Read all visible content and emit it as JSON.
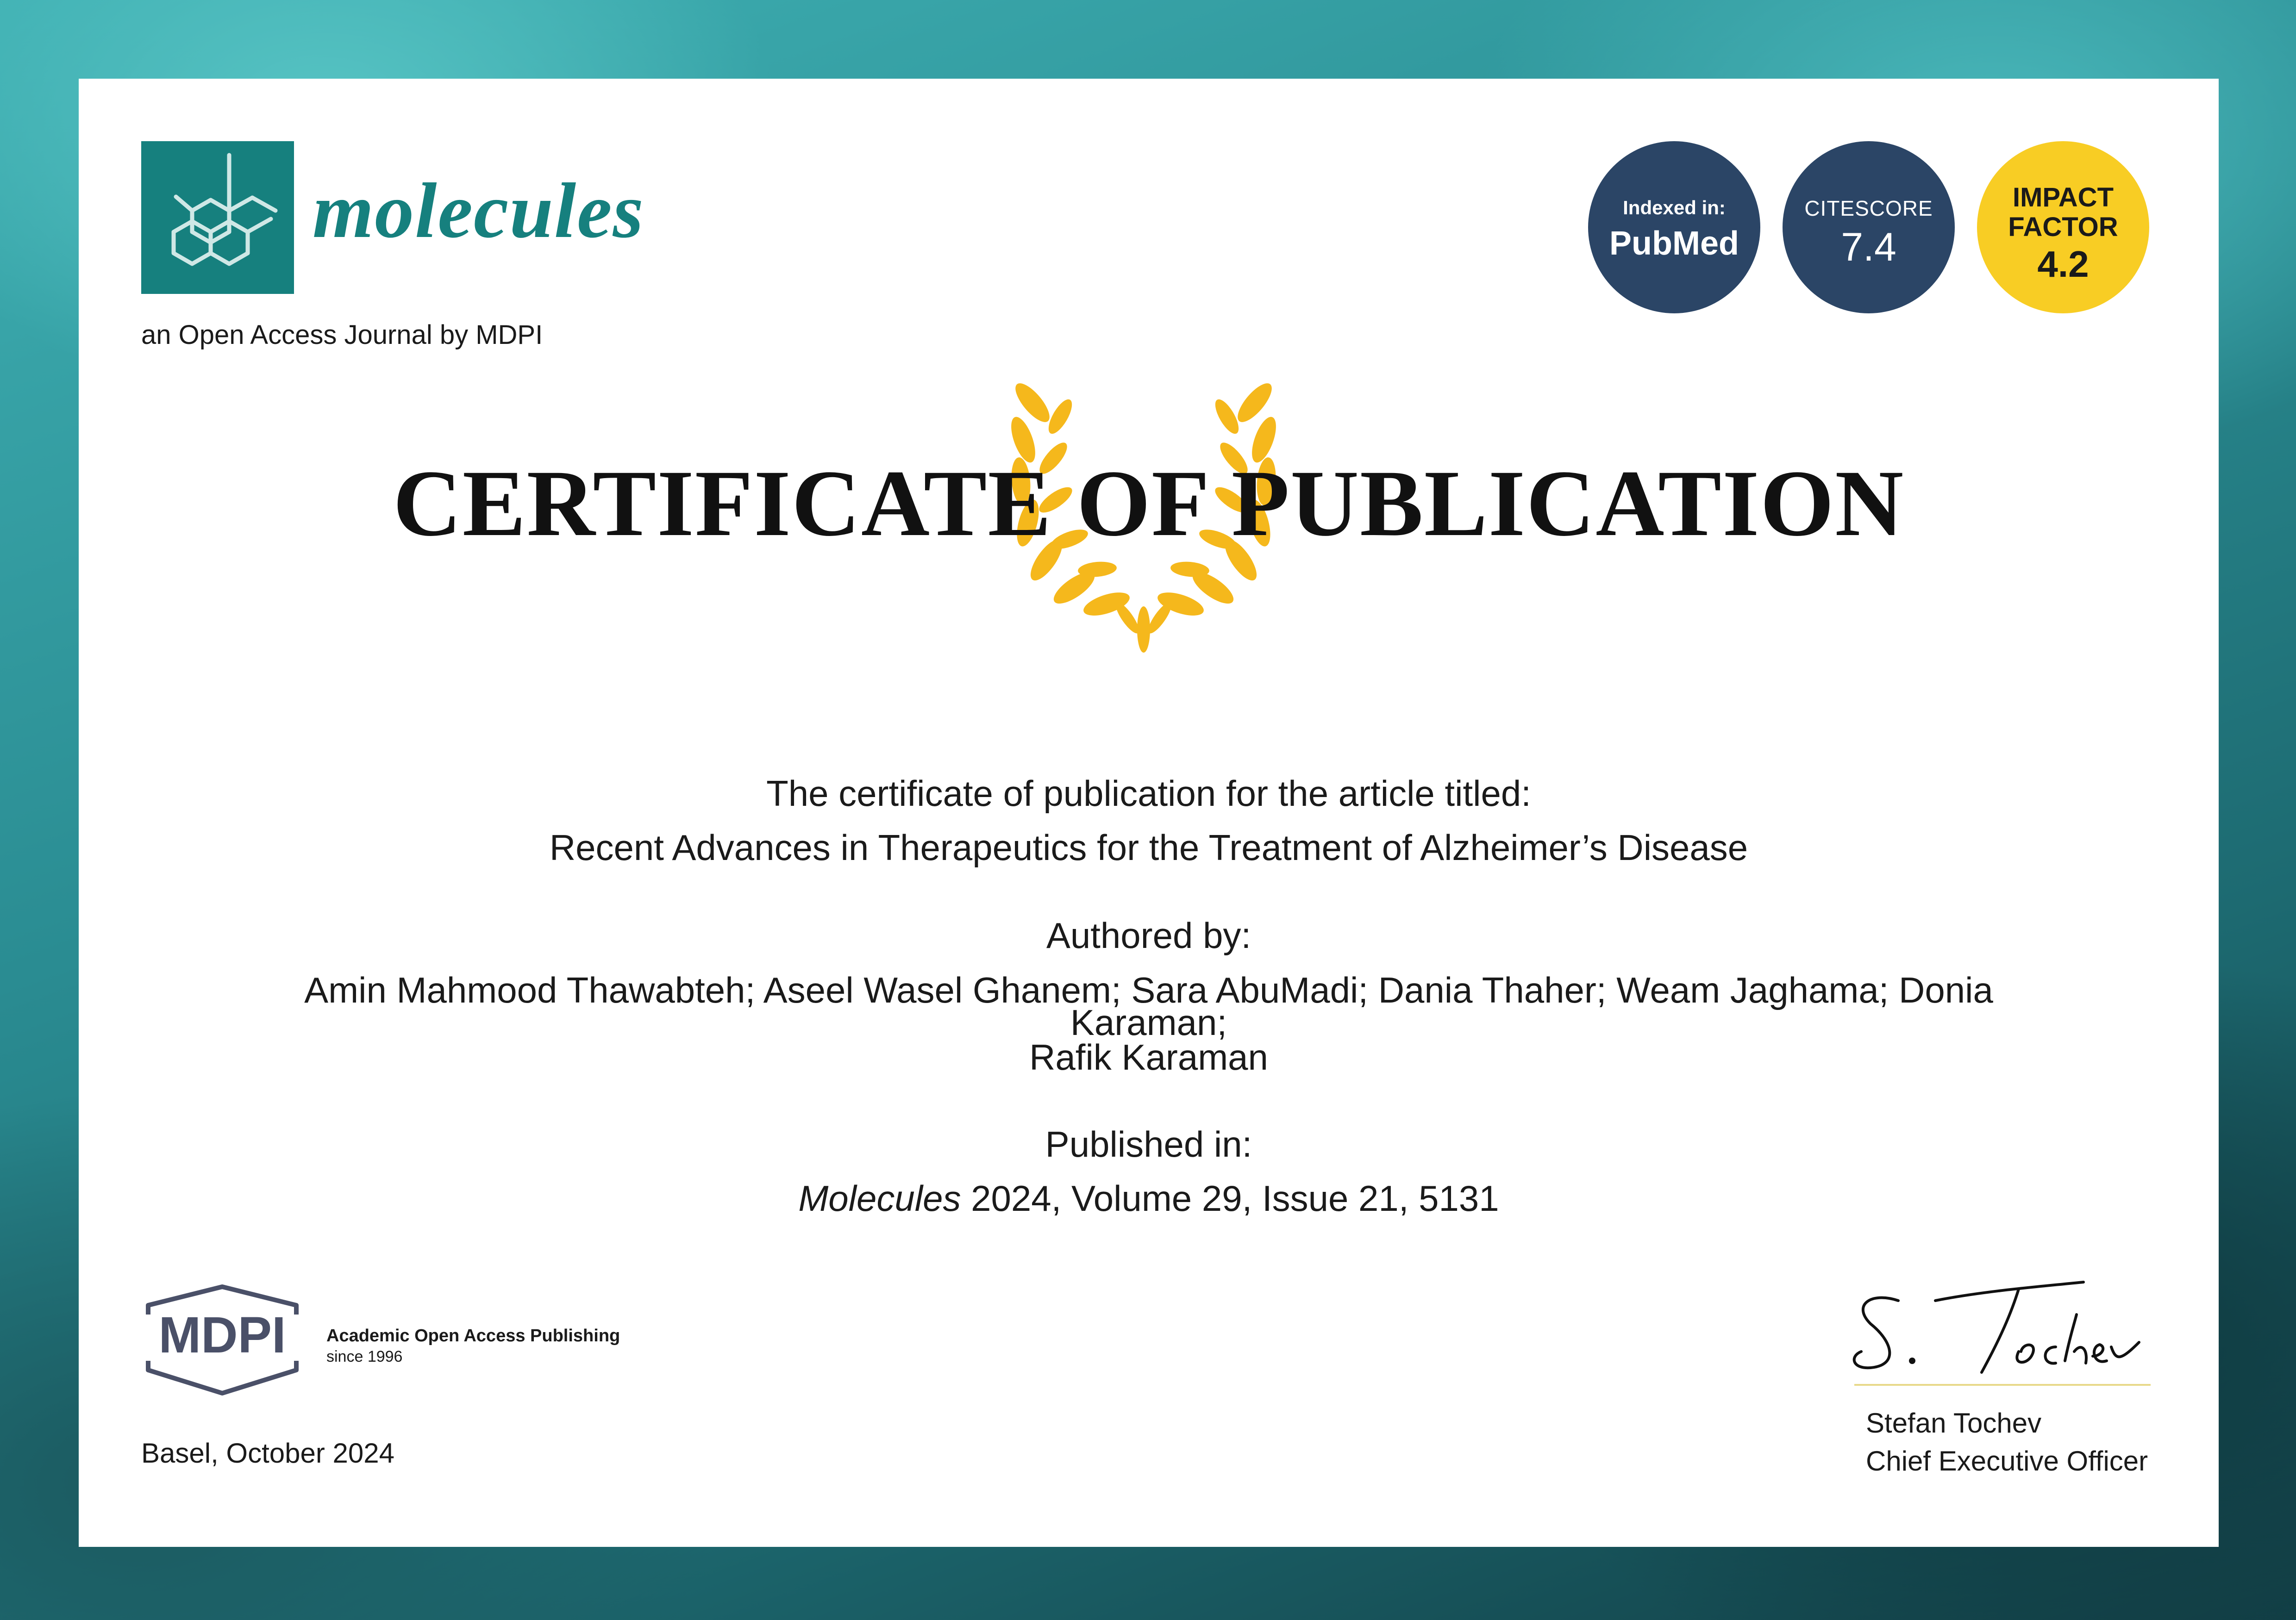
{
  "journal": {
    "name": "molecules",
    "tagline": "an Open Access Journal by MDPI"
  },
  "badges": {
    "indexed_label": "Indexed in:",
    "indexed_value": "PubMed",
    "citescore_label": "CITESCORE",
    "citescore_value": "7.4",
    "impact_label_1": "IMPACT",
    "impact_label_2": "FACTOR",
    "impact_value": "4.2"
  },
  "certificate": {
    "title": "CERTIFICATE OF PUBLICATION",
    "intro": "The certificate of publication for the article titled:",
    "article_title": "Recent Advances in Therapeutics for the Treatment of Alzheimer’s Disease",
    "authored_label": "Authored by:",
    "authors_line1": "Amin Mahmood Thawabteh; Aseel Wasel Ghanem; Sara AbuMadi; Dania Thaher; Weam Jaghama; Donia",
    "authors_line2": "Karaman;",
    "authors_line3": "Rafik Karaman",
    "published_label": "Published in:",
    "journal_italic": "Molecules",
    "year": "2024",
    "citation_rest": ", Volume 29, Issue 21, 5131"
  },
  "publisher": {
    "logo_text": "MDPI",
    "tagline_1": "Academic Open Access Publishing",
    "tagline_2": "since 1996"
  },
  "footer": {
    "place_date": "Basel, October 2024",
    "signatory_name": "Stefan Tochev",
    "signatory_role": "Chief Executive Officer"
  },
  "colors": {
    "journal_teal": "#16807e",
    "badge_navy": "#2b4566",
    "badge_yellow": "#f8cd24",
    "wreath_gold": "#f5b81c"
  }
}
